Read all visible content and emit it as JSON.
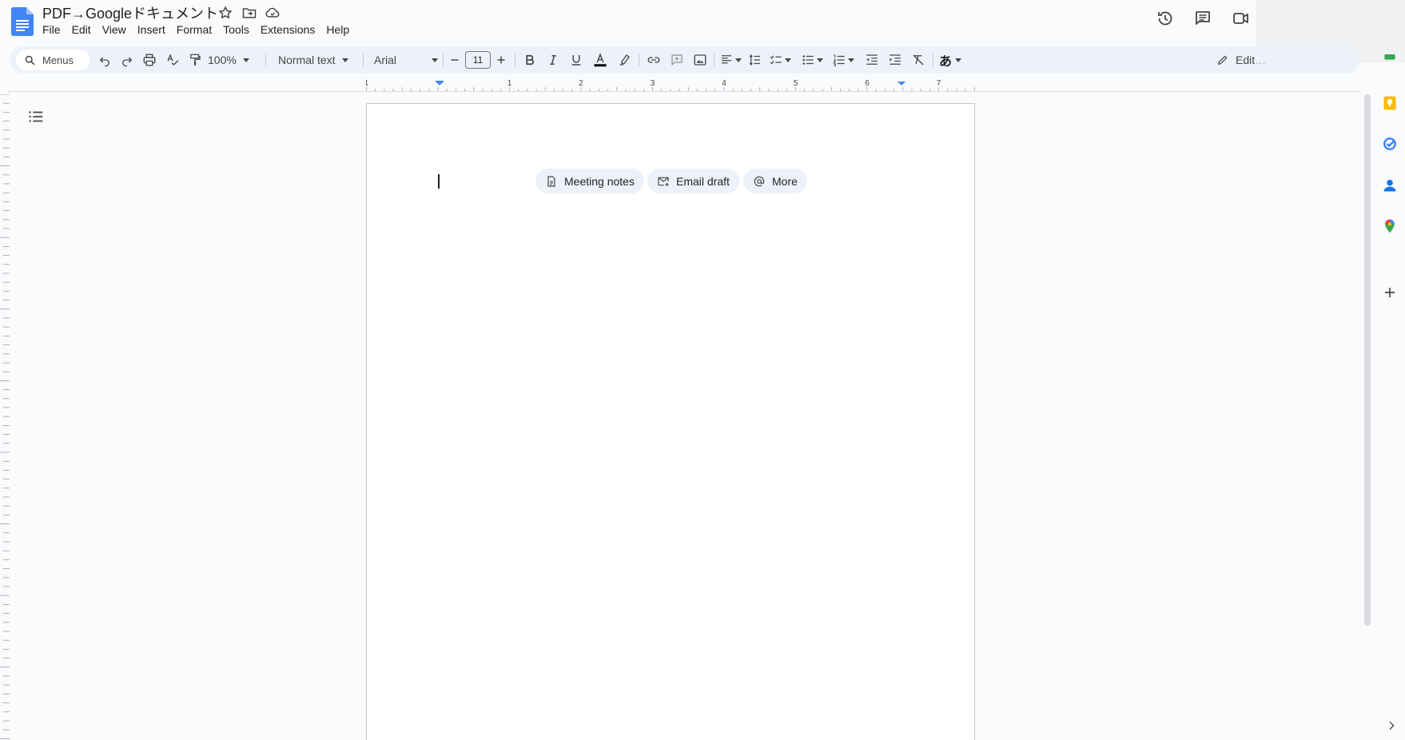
{
  "document": {
    "title": "PDF→Googleドキュメント"
  },
  "menubar": {
    "items": [
      "File",
      "Edit",
      "View",
      "Insert",
      "Format",
      "Tools",
      "Extensions",
      "Help"
    ]
  },
  "toolbar": {
    "search_label": "Menus",
    "zoom": "100%",
    "paragraph_style": "Normal text",
    "font_family": "Arial",
    "font_size": "11",
    "editing_mode": "Edit"
  },
  "ruler": {
    "labels": [
      "1",
      "1",
      "2",
      "3",
      "4",
      "5",
      "6",
      "7"
    ]
  },
  "chips": {
    "meeting_notes": "Meeting notes",
    "email_draft": "Email draft",
    "more": "More"
  },
  "icons": {
    "title_bar": [
      "star-icon",
      "move-to-folder-icon",
      "cloud-saved-icon"
    ],
    "top_right": [
      "version-history-icon",
      "comments-icon",
      "meet-video-icon"
    ],
    "side_panel": [
      "keep-icon",
      "tasks-icon",
      "contacts-icon",
      "maps-icon",
      "add-icon"
    ]
  },
  "colors": {
    "docs_blue": "#4285f4",
    "keep_yellow": "#fbbc04",
    "toolbar_bg": "#edf2fa",
    "ruler_marker": "#4285f4"
  }
}
